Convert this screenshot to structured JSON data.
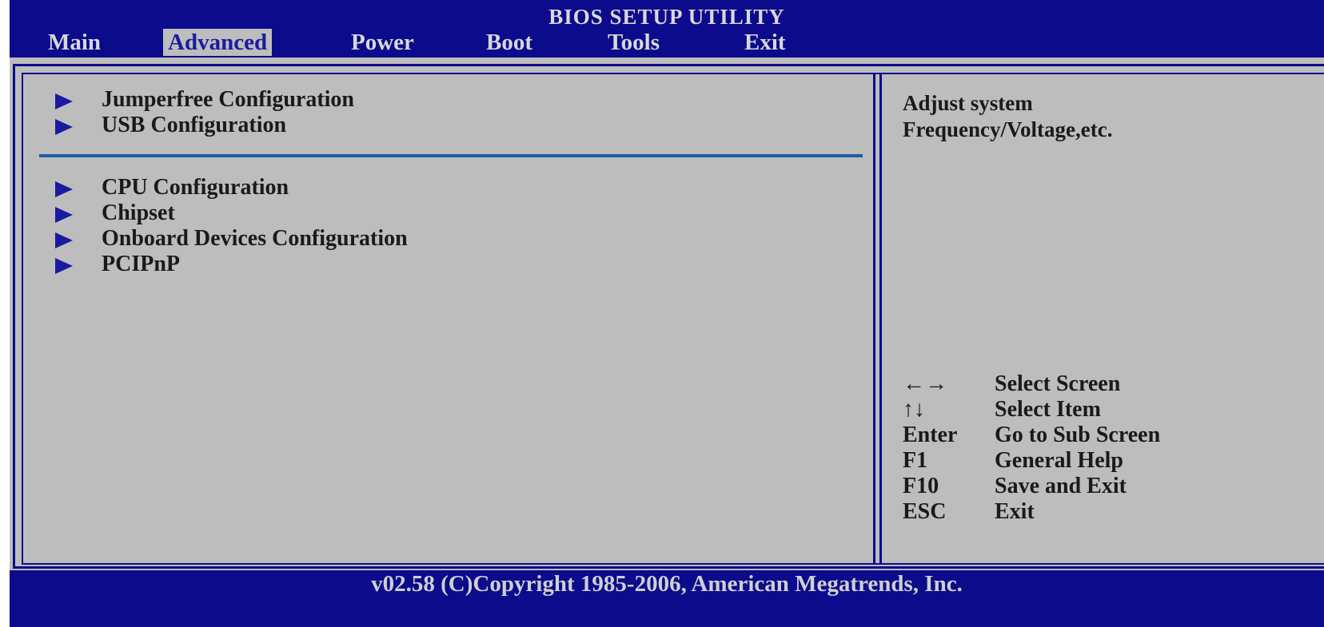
{
  "title": "BIOS SETUP UTILITY",
  "tabs": [
    {
      "label": "Main",
      "active": false
    },
    {
      "label": "Advanced",
      "active": true
    },
    {
      "label": "Power",
      "active": false
    },
    {
      "label": "Boot",
      "active": false
    },
    {
      "label": "Tools",
      "active": false
    },
    {
      "label": "Exit",
      "active": false
    }
  ],
  "menu": {
    "group1": [
      {
        "label": "Jumperfree Configuration"
      },
      {
        "label": "USB Configuration"
      }
    ],
    "group2": [
      {
        "label": "CPU Configuration"
      },
      {
        "label": "Chipset"
      },
      {
        "label": "Onboard Devices Configuration"
      },
      {
        "label": "PCIPnP"
      }
    ]
  },
  "help": {
    "line1": "Adjust system",
    "line2": "Frequency/Voltage,etc."
  },
  "keys": [
    {
      "key": "←→",
      "desc": "Select Screen"
    },
    {
      "key": "↑↓",
      "desc": "Select Item"
    },
    {
      "key": "Enter",
      "desc": "Go to Sub Screen"
    },
    {
      "key": "F1",
      "desc": "General Help"
    },
    {
      "key": "F10",
      "desc": "Save and Exit"
    },
    {
      "key": "ESC",
      "desc": "Exit"
    }
  ],
  "footer": "v02.58 (C)Copyright 1985-2006, American Megatrends, Inc.",
  "colors": {
    "bar": "#0b0b8c",
    "panel": "#bdbdbd",
    "accent": "#1a1aa0"
  }
}
